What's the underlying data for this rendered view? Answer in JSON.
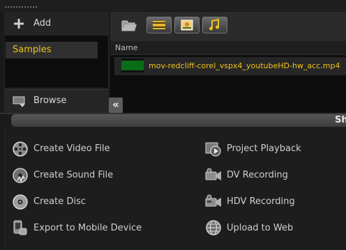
{
  "library": {
    "add_label": "Add",
    "selected_item": "Samples",
    "browse_label": "Browse"
  },
  "toolbar": {
    "buttons": [
      "video",
      "photo",
      "audio"
    ]
  },
  "file_list": {
    "column_name": "Name",
    "files": [
      {
        "name": "mov-redcliff-corel_vspx4_youtubeHD-hw_acc.mp4"
      }
    ]
  },
  "collapse_glyph": "«",
  "show_bar_label": "Sh",
  "actions": {
    "left": [
      {
        "label": "Create Video File",
        "icon": "film-reel-icon"
      },
      {
        "label": "Create Sound File",
        "icon": "sound-file-icon"
      },
      {
        "label": "Create Disc",
        "icon": "disc-icon"
      },
      {
        "label": "Export to Mobile Device",
        "icon": "mobile-device-icon"
      }
    ],
    "right": [
      {
        "label": "Project Playback",
        "icon": "project-playback-icon"
      },
      {
        "label": "DV Recording",
        "icon": "dv-camera-icon"
      },
      {
        "label": "HDV Recording",
        "icon": "hdv-camera-icon"
      },
      {
        "label": "Upload to Web",
        "icon": "globe-icon"
      }
    ]
  },
  "colors": {
    "accent": "#f2c21b",
    "background": "#1a1a1a"
  }
}
